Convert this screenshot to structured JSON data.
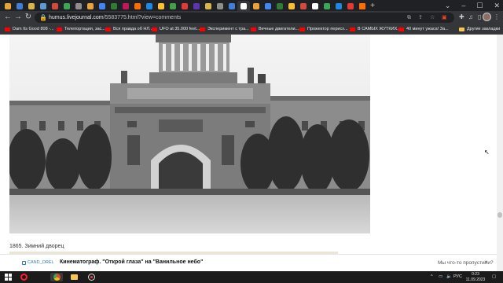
{
  "browser": {
    "url_host": "humus.livejournal.com",
    "url_path": "/5583775.html?view=comments",
    "bookmarks": [
      {
        "label": "Dam Its Good 808 -...",
        "icon": "youtube-icon"
      },
      {
        "label": "Телепортация, зас...",
        "icon": "youtube-icon"
      },
      {
        "label": "Вся правда об НЛ...",
        "icon": "youtube-icon"
      },
      {
        "label": "UFO at 35.000 feet...",
        "icon": "youtube-icon"
      },
      {
        "label": "Эксперимент с тра...",
        "icon": "youtube-icon"
      },
      {
        "label": "Вечные двигатели...",
        "icon": "youtube-icon"
      },
      {
        "label": "Прожектор перисх...",
        "icon": "youtube-icon"
      },
      {
        "label": "В САМЫХ ЖУТКИХ...",
        "icon": "youtube-icon"
      },
      {
        "label": "40 минут ужаса! За...",
        "icon": "youtube-icon"
      },
      {
        "label": "Другие закладки",
        "icon": "folder-icon"
      }
    ]
  },
  "page": {
    "photo_caption": "1865. Зимний дворец",
    "comment_bar": {
      "username": "CAND_OREL",
      "title": "Кинематограф. \"Открой глаза\" на \"Ванильное небо\"",
      "missed": "Мы что-то пропустили?",
      "close": "×"
    }
  },
  "taskbar": {
    "language": "РУС",
    "time": "0:23",
    "date": "11.09.2023"
  },
  "colors": {
    "tab_strip": "#202124",
    "toolbar": "#35363a",
    "link": "#2b7bb9",
    "taskbar": "#1b1b1b"
  }
}
